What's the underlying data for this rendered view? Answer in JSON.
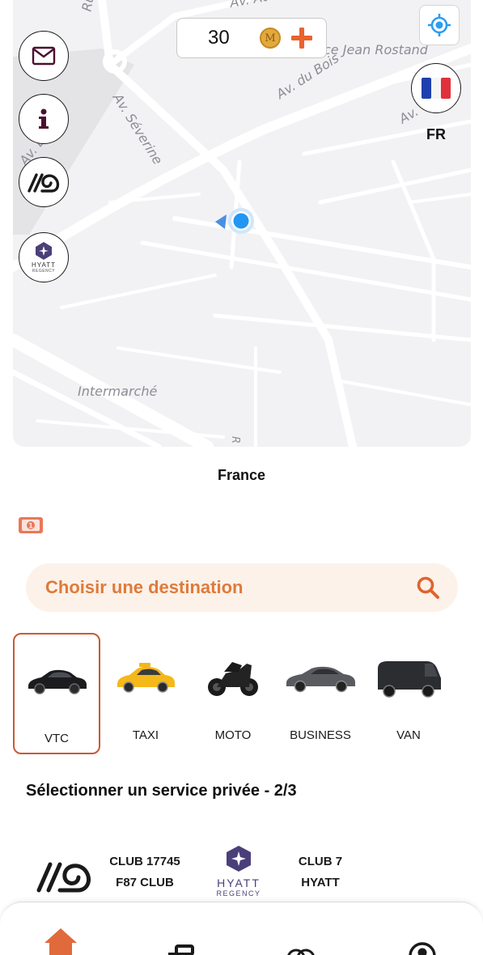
{
  "map": {
    "labels": {
      "street1": "Ru",
      "street2": "Av. At",
      "street3": "ce Jean Rostand",
      "street4": "Av. du Bois",
      "street5": "Av. Séverine",
      "street6": "Av. Léon",
      "street7": "Av.",
      "street8": "Intermarché",
      "street9": "R"
    },
    "coins": "30",
    "coin_symbol": "M",
    "language": "FR"
  },
  "location": {
    "country": "France"
  },
  "search": {
    "placeholder": "Choisir une destination"
  },
  "vehicles": [
    {
      "label": "VTC",
      "selected": true
    },
    {
      "label": "TAXI",
      "selected": false
    },
    {
      "label": "MOTO",
      "selected": false
    },
    {
      "label": "BUSINESS",
      "selected": false
    },
    {
      "label": "VAN",
      "selected": false
    }
  ],
  "service": {
    "title": "Sélectionner un service privée  - 2/3",
    "clubs": [
      {
        "line1": "CLUB 17745",
        "line2": "F87 CLUB"
      },
      {
        "line1": "CLUB 7",
        "line2": "HYATT"
      }
    ],
    "hyatt_logo_text": {
      "name": "HYATT",
      "sub": "REGENCY"
    }
  },
  "colors": {
    "accent": "#e07a3a",
    "selected_border": "#c95a35",
    "location_dot": "#2196f3",
    "home_icon": "#e06a3c"
  },
  "icons": {
    "mail": "mail-icon",
    "info": "info-icon",
    "club_logo": "f87-club-logo",
    "hyatt": "hyatt-regency-logo",
    "locate": "locate-icon",
    "flag": "france-flag-icon",
    "cash": "cash-icon",
    "search": "search-icon",
    "home": "home-icon"
  }
}
